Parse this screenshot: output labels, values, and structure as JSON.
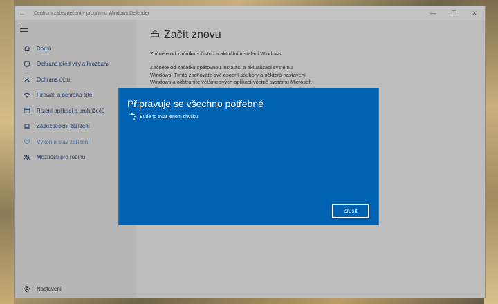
{
  "window": {
    "title": "Centrum zabezpečení v programu Windows Defender",
    "back_icon": "back-arrow-icon",
    "minimize": "—",
    "maximize": "☐",
    "close": "✕"
  },
  "sidebar": {
    "items": [
      {
        "label": "Domů",
        "icon": "home-icon"
      },
      {
        "label": "Ochrana před viry a hrozbami",
        "icon": "shield-icon"
      },
      {
        "label": "Ochrana účtu",
        "icon": "person-icon"
      },
      {
        "label": "Firewall a ochrana sítě",
        "icon": "wifi-icon"
      },
      {
        "label": "Řízení aplikací a prohlížečů",
        "icon": "app-browser-icon"
      },
      {
        "label": "Zabezpečení zařízení",
        "icon": "laptop-icon"
      },
      {
        "label": "Výkon a stav zařízení",
        "icon": "heart-icon",
        "active": true
      },
      {
        "label": "Možnosti pro rodinu",
        "icon": "family-icon"
      }
    ],
    "settings_label": "Nastavení"
  },
  "main": {
    "title": "Začít znovu",
    "para1": "Začněte od začátku s čistou a aktuální instalací Windows.",
    "para2": "Začněte od začátku opětovnou instalací a aktualizací systému Windows. Tímto zachováte své osobní soubory a některá nastavení Windows a odstraníte většinu svých aplikací včetně systému Microsoft Office, antivirového softwaru třetích stran a desktopových aplikací, které byly na"
  },
  "dialog": {
    "title": "Připravuje se všechno potřebné",
    "message": "Bude to trvat jenom chvilku.",
    "cancel_label": "Zrušit"
  },
  "colors": {
    "dialog_bg": "#0063b1",
    "accent": "#1f3a66"
  }
}
